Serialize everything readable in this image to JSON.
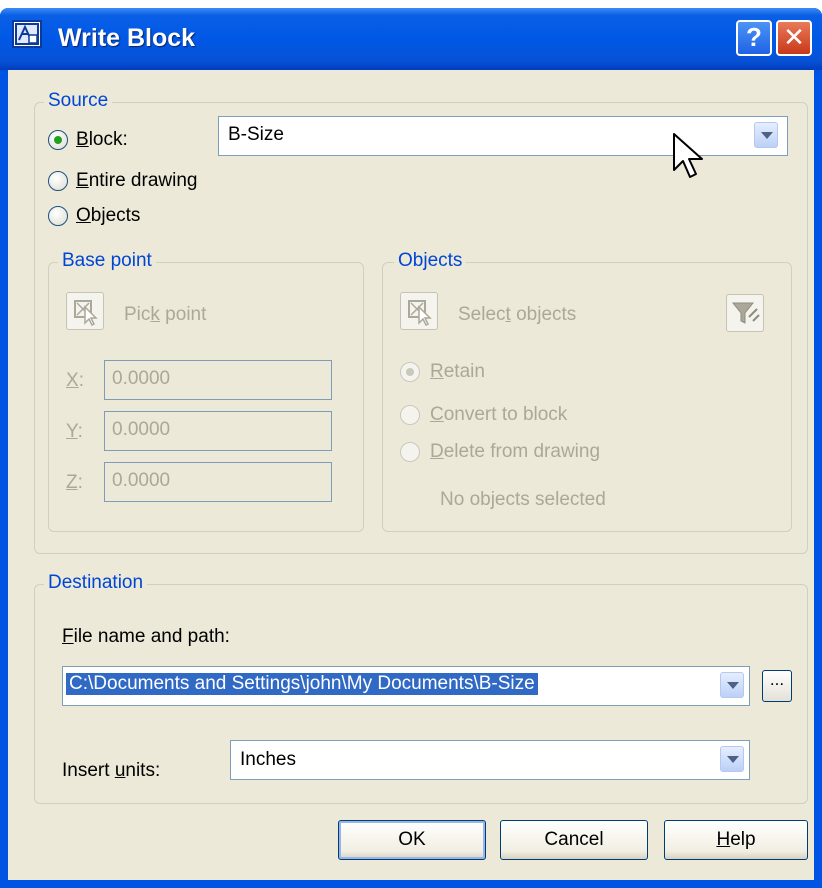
{
  "window": {
    "title": "Write Block",
    "help_label": "?",
    "close_label": "✕"
  },
  "source": {
    "legend": "Source",
    "options": [
      {
        "label_prefix": "",
        "mnemonic": "B",
        "label_rest": "lock:",
        "checked": true
      },
      {
        "label_prefix": "",
        "mnemonic": "E",
        "label_rest": "ntire drawing",
        "checked": false
      },
      {
        "label_prefix": "",
        "mnemonic": "O",
        "label_rest": "bjects",
        "checked": false
      }
    ],
    "block_combo_value": "B-Size"
  },
  "base_point": {
    "legend": "Base point",
    "pick_label_pre": "Pic",
    "pick_label_mnemonic": "k",
    "pick_label_post": " point",
    "x_label": "X",
    "y_label": "Y",
    "z_label": "Z",
    "x_value": "0.0000",
    "y_value": "0.0000",
    "z_value": "0.0000"
  },
  "objects": {
    "legend": "Objects",
    "select_label_pre": "Selec",
    "select_label_mnemonic": "t",
    "select_label_post": " objects",
    "retain_mnemonic": "R",
    "retain_rest": "etain",
    "convert_mnemonic": "C",
    "convert_rest": "onvert to block",
    "delete_mnemonic": "D",
    "delete_rest": "elete from drawing",
    "status": "No objects selected"
  },
  "destination": {
    "legend": "Destination",
    "file_label_mnemonic": "F",
    "file_label_rest": "ile name and path:",
    "file_path": "C:\\Documents and Settings\\john\\My Documents\\B-Size",
    "browse_label": "...",
    "units_label_pre": "Insert ",
    "units_label_mnemonic": "u",
    "units_label_post": "nits:",
    "units_value": "Inches"
  },
  "buttons": {
    "ok": "OK",
    "cancel": "Cancel",
    "help_mnemonic": "H",
    "help_rest": "elp"
  }
}
